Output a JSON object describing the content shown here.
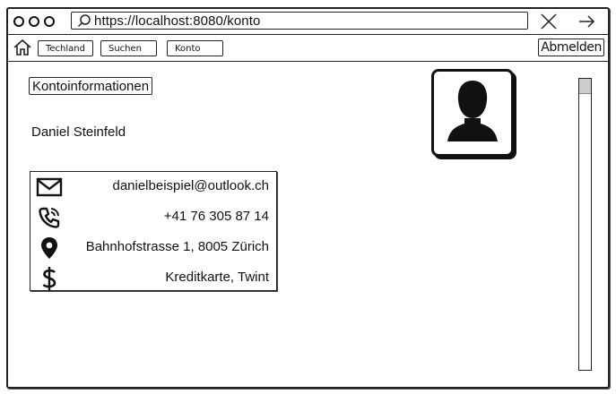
{
  "browser": {
    "url": "https://localhost:8080/konto"
  },
  "nav": {
    "items": [
      {
        "label": "Techland"
      },
      {
        "label": "Suchen"
      },
      {
        "label": "Konto"
      }
    ],
    "logout_label": "Abmelden"
  },
  "main": {
    "section_title": "Kontoinformationen",
    "user_name": "Daniel Steinfeld",
    "info": [
      {
        "icon": "mail-icon",
        "value": "danielbeispiel@outlook.ch"
      },
      {
        "icon": "phone-icon",
        "value": "+41 76 305 87 14"
      },
      {
        "icon": "location-pin-icon",
        "value": "Bahnhofstrasse 1, 8005 Zürich"
      },
      {
        "icon": "dollar-icon",
        "value": "Kreditkarte, Twint"
      }
    ]
  }
}
